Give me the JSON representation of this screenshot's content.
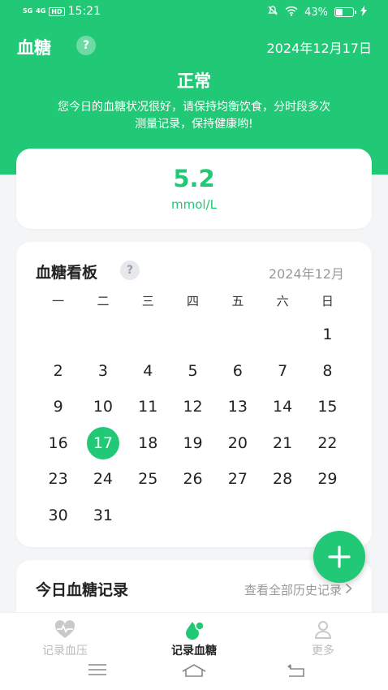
{
  "status_bar": {
    "net1": "5G",
    "net2": "4G",
    "hd": "HD",
    "time": "15:21",
    "battery": "43%",
    "battery_level": 0.43
  },
  "header": {
    "title": "血糖",
    "help": "?",
    "date": "2024年12月17日",
    "status": "正常",
    "description": "您今日的血糖状况很好，请保持均衡饮食，分时段多次测量记录，保持健康哟!"
  },
  "reading": {
    "value": "5.2",
    "unit": "mmol/L"
  },
  "calendar": {
    "title": "血糖看板",
    "help": "?",
    "month": "2024年12月",
    "weekdays": [
      "一",
      "二",
      "三",
      "四",
      "五",
      "六",
      "日"
    ],
    "weeks": [
      [
        "",
        "",
        "",
        "",
        "",
        "",
        "1"
      ],
      [
        "2",
        "3",
        "4",
        "5",
        "6",
        "7",
        "8"
      ],
      [
        "9",
        "10",
        "11",
        "12",
        "13",
        "14",
        "15"
      ],
      [
        "16",
        "17",
        "18",
        "19",
        "20",
        "21",
        "22"
      ],
      [
        "23",
        "24",
        "25",
        "26",
        "27",
        "28",
        "29"
      ],
      [
        "30",
        "31",
        "",
        "",
        "",
        "",
        ""
      ]
    ],
    "today": "17"
  },
  "records": {
    "title": "今日血糖记录",
    "view_all": "查看全部历史记录"
  },
  "bottom_nav": [
    {
      "label": "记录血压",
      "icon": "heart-pulse-icon"
    },
    {
      "label": "记录血糖",
      "icon": "blood-drop-icon"
    },
    {
      "label": "更多",
      "icon": "user-icon"
    }
  ],
  "colors": {
    "accent": "#21c875"
  }
}
